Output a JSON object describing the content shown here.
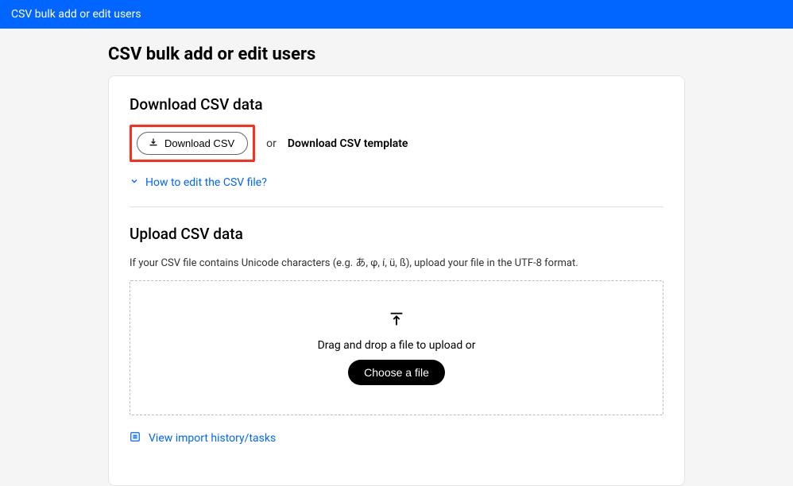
{
  "top_bar": {
    "title": "CSV bulk add or edit users"
  },
  "page": {
    "title": "CSV bulk add or edit users"
  },
  "download_section": {
    "heading": "Download CSV data",
    "download_btn_label": "Download CSV",
    "or_text": "or",
    "template_link": "Download CSV template",
    "expand_link": "How to edit the CSV file?"
  },
  "upload_section": {
    "heading": "Upload CSV data",
    "helper_text": "If your CSV file contains Unicode characters (e.g. あ, φ, í, ü, ß), upload your file in the UTF-8 format.",
    "drop_text": "Drag and drop a file to upload or",
    "choose_btn_label": "Choose a file"
  },
  "footer": {
    "history_link": "View import history/tasks"
  }
}
